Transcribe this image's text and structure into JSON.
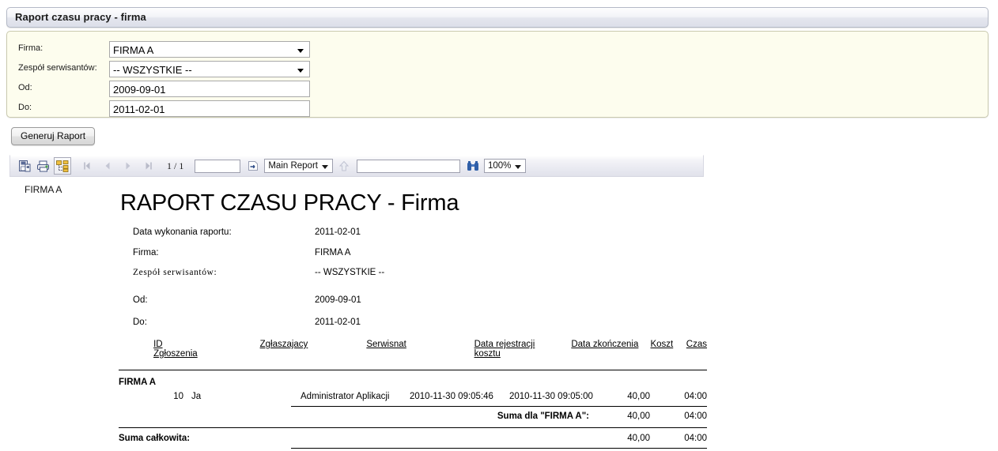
{
  "window": {
    "title": "Raport czasu pracy - firma"
  },
  "criteria": {
    "rows": [
      {
        "label": "Firma:",
        "value": "FIRMA A",
        "kind": "select"
      },
      {
        "label": "Zespół serwisantów:",
        "value": "-- WSZYSTKIE --",
        "kind": "select"
      },
      {
        "label": "Od:",
        "value": "2009-09-01",
        "kind": "text"
      },
      {
        "label": "Do:",
        "value": "2011-02-01",
        "kind": "text"
      }
    ],
    "generate_button": "Generuj Raport"
  },
  "viewer_toolbar": {
    "export_icon": "export-disk-icon",
    "print_icon": "printer-icon",
    "group_tree_icon": "toggle-group-tree-icon",
    "first_page_icon": "first-page-icon",
    "prev_page_icon": "previous-page-icon",
    "next_page_icon": "next-page-icon",
    "last_page_icon": "last-page-icon",
    "page_info": "1 / 1",
    "goto_page_value": "",
    "goto_icon": "go-to-page-icon",
    "report_select": "Main Report",
    "up_icon": "go-to-parent-icon",
    "search_value": "",
    "search_icon": "binoculars-search-icon",
    "zoom_value": "100%"
  },
  "report": {
    "corner_company": "FIRMA A",
    "title": "RAPORT CZASU PRACY - Firma",
    "meta": [
      {
        "label": "Data wykonania raportu:",
        "value": "2011-02-01"
      },
      {
        "label": "Firma:",
        "value": "FIRMA A"
      },
      {
        "label": "Zespół serwisantów:",
        "value": "-- WSZYSTKIE --"
      },
      {
        "label": "Od:",
        "value": "2009-09-01"
      },
      {
        "label": "Do:",
        "value": "2011-02-01"
      }
    ],
    "columns": {
      "id_line1": "ID",
      "id_line2": "Zgłoszenia",
      "reporter": "Zgłaszajacy",
      "technician": "Serwisnat",
      "reg_line1": "Data rejestracji",
      "reg_line2": "kosztu",
      "end_date": "Data zkończenia",
      "cost": "Koszt",
      "time": "Czas"
    },
    "group_label": "FIRMA A",
    "rows": [
      {
        "id": "10",
        "reporter": "Ja",
        "technician": "Administrator Aplikacji",
        "registered": "2010-11-30  09:05:46",
        "finished": "2010-11-30  09:05:00",
        "cost": "40,00",
        "time": "04:00"
      }
    ],
    "subtotal": {
      "label": "Suma dla \"FIRMA A\":",
      "cost": "40,00",
      "time": "04:00"
    },
    "grand_total": {
      "label": "Suma całkowita:",
      "cost": "40,00",
      "time": "04:00"
    }
  }
}
